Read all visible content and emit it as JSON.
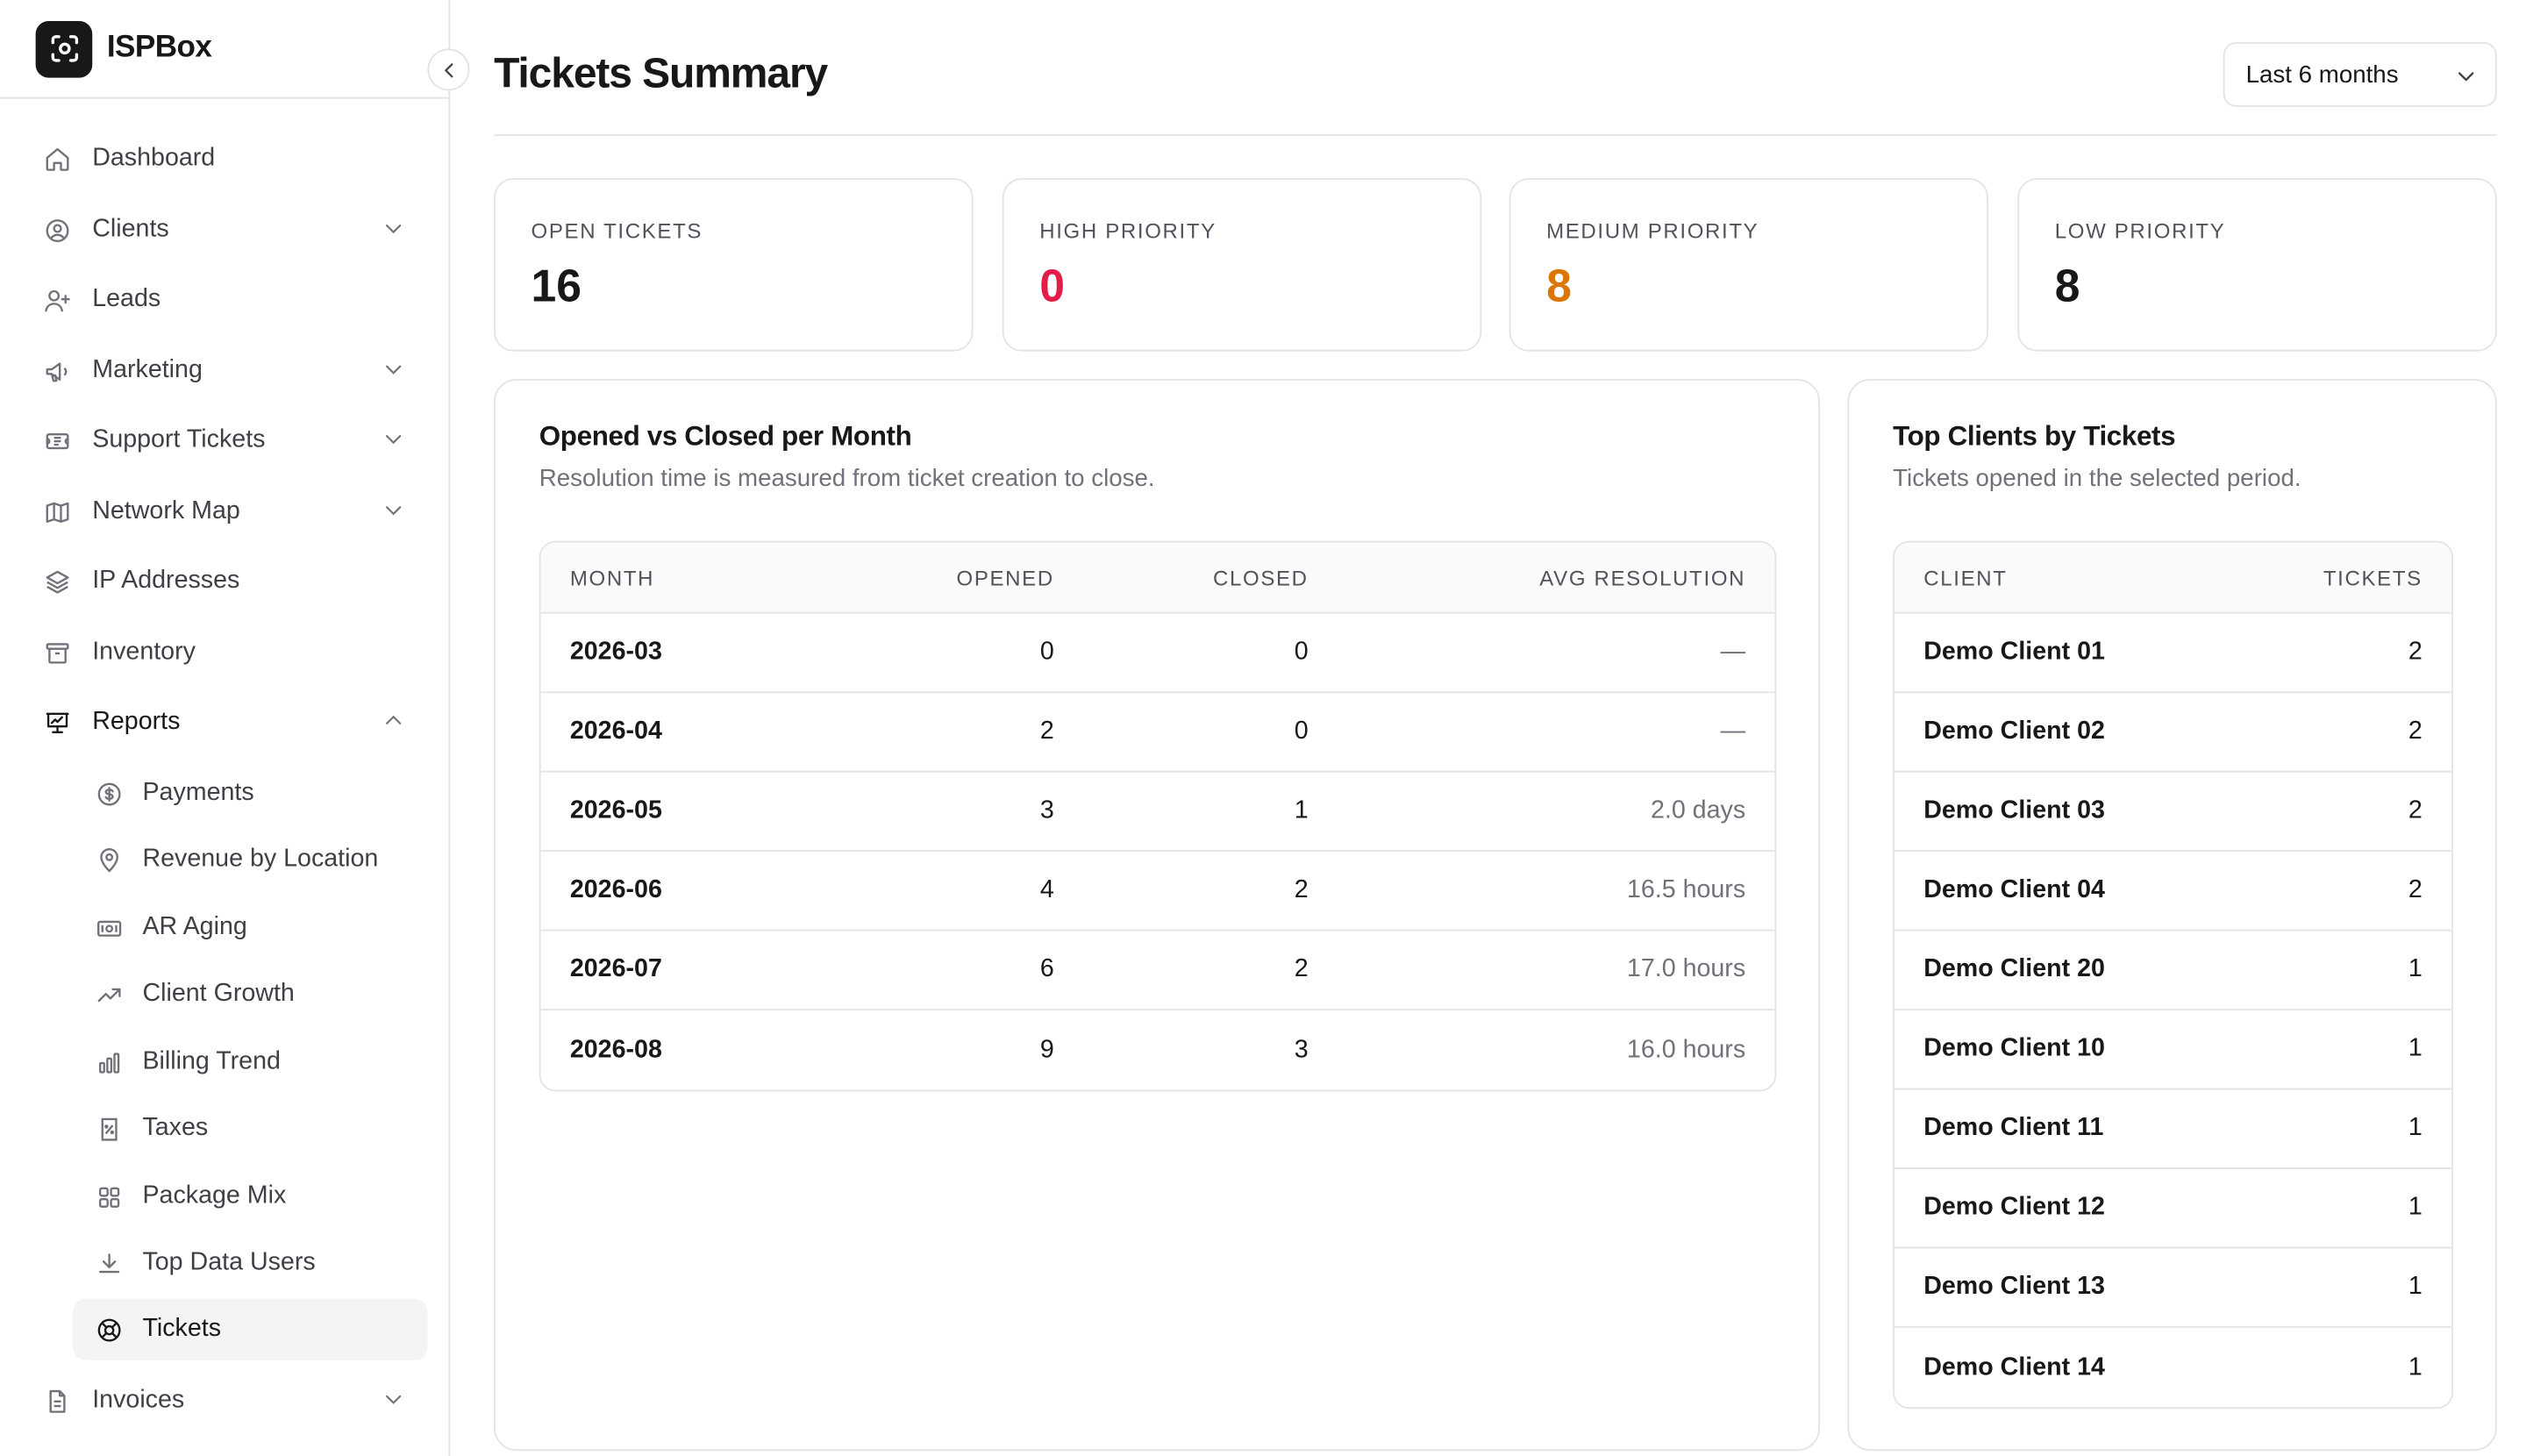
{
  "app": {
    "name": "ISPBox"
  },
  "sidebar": {
    "items": [
      {
        "label": "Dashboard",
        "icon": "home-icon"
      },
      {
        "label": "Clients",
        "icon": "user-circle-icon",
        "expandable": true
      },
      {
        "label": "Leads",
        "icon": "user-plus-icon"
      },
      {
        "label": "Marketing",
        "icon": "megaphone-icon",
        "expandable": true
      },
      {
        "label": "Support Tickets",
        "icon": "ticket-icon",
        "expandable": true
      },
      {
        "label": "Network Map",
        "icon": "map-icon",
        "expandable": true
      },
      {
        "label": "IP Addresses",
        "icon": "layers-icon"
      },
      {
        "label": "Inventory",
        "icon": "archive-icon"
      },
      {
        "label": "Reports",
        "icon": "presentation-chart-icon",
        "expandable": true,
        "expanded": true
      },
      {
        "label": "Invoices",
        "icon": "document-icon",
        "expandable": true
      }
    ],
    "reports_children": [
      {
        "label": "Payments",
        "icon": "dollar-circle-icon"
      },
      {
        "label": "Revenue by Location",
        "icon": "map-pin-icon"
      },
      {
        "label": "AR Aging",
        "icon": "banknote-icon"
      },
      {
        "label": "Client Growth",
        "icon": "trending-up-icon"
      },
      {
        "label": "Billing Trend",
        "icon": "bar-chart-icon"
      },
      {
        "label": "Taxes",
        "icon": "receipt-percent-icon"
      },
      {
        "label": "Package Mix",
        "icon": "grid-icon"
      },
      {
        "label": "Top Data Users",
        "icon": "download-icon"
      },
      {
        "label": "Tickets",
        "icon": "lifebuoy-icon",
        "selected": true
      }
    ]
  },
  "header": {
    "title": "Tickets Summary",
    "range_select": {
      "value": "Last 6 months"
    }
  },
  "stats": [
    {
      "label": "OPEN TICKETS",
      "value": "16",
      "color": "#18181b"
    },
    {
      "label": "HIGH PRIORITY",
      "value": "0",
      "color": "#e11d48"
    },
    {
      "label": "MEDIUM PRIORITY",
      "value": "8",
      "color": "#d97706"
    },
    {
      "label": "LOW PRIORITY",
      "value": "8",
      "color": "#18181b"
    }
  ],
  "monthly_panel": {
    "title": "Opened vs Closed per Month",
    "subtitle": "Resolution time is measured from ticket creation to close.",
    "columns": [
      "MONTH",
      "OPENED",
      "CLOSED",
      "AVG RESOLUTION"
    ],
    "rows": [
      {
        "month": "2026-03",
        "opened": "0",
        "closed": "0",
        "avg": "—"
      },
      {
        "month": "2026-04",
        "opened": "2",
        "closed": "0",
        "avg": "—"
      },
      {
        "month": "2026-05",
        "opened": "3",
        "closed": "1",
        "avg": "2.0 days"
      },
      {
        "month": "2026-06",
        "opened": "4",
        "closed": "2",
        "avg": "16.5 hours"
      },
      {
        "month": "2026-07",
        "opened": "6",
        "closed": "2",
        "avg": "17.0 hours"
      },
      {
        "month": "2026-08",
        "opened": "9",
        "closed": "3",
        "avg": "16.0 hours"
      }
    ]
  },
  "clients_panel": {
    "title": "Top Clients by Tickets",
    "subtitle": "Tickets opened in the selected period.",
    "columns": [
      "CLIENT",
      "TICKETS"
    ],
    "rows": [
      {
        "client": "Demo Client 01",
        "tickets": "2"
      },
      {
        "client": "Demo Client 02",
        "tickets": "2"
      },
      {
        "client": "Demo Client 03",
        "tickets": "2"
      },
      {
        "client": "Demo Client 04",
        "tickets": "2"
      },
      {
        "client": "Demo Client 20",
        "tickets": "1"
      },
      {
        "client": "Demo Client 10",
        "tickets": "1"
      },
      {
        "client": "Demo Client 11",
        "tickets": "1"
      },
      {
        "client": "Demo Client 12",
        "tickets": "1"
      },
      {
        "client": "Demo Client 13",
        "tickets": "1"
      },
      {
        "client": "Demo Client 14",
        "tickets": "1"
      }
    ]
  }
}
